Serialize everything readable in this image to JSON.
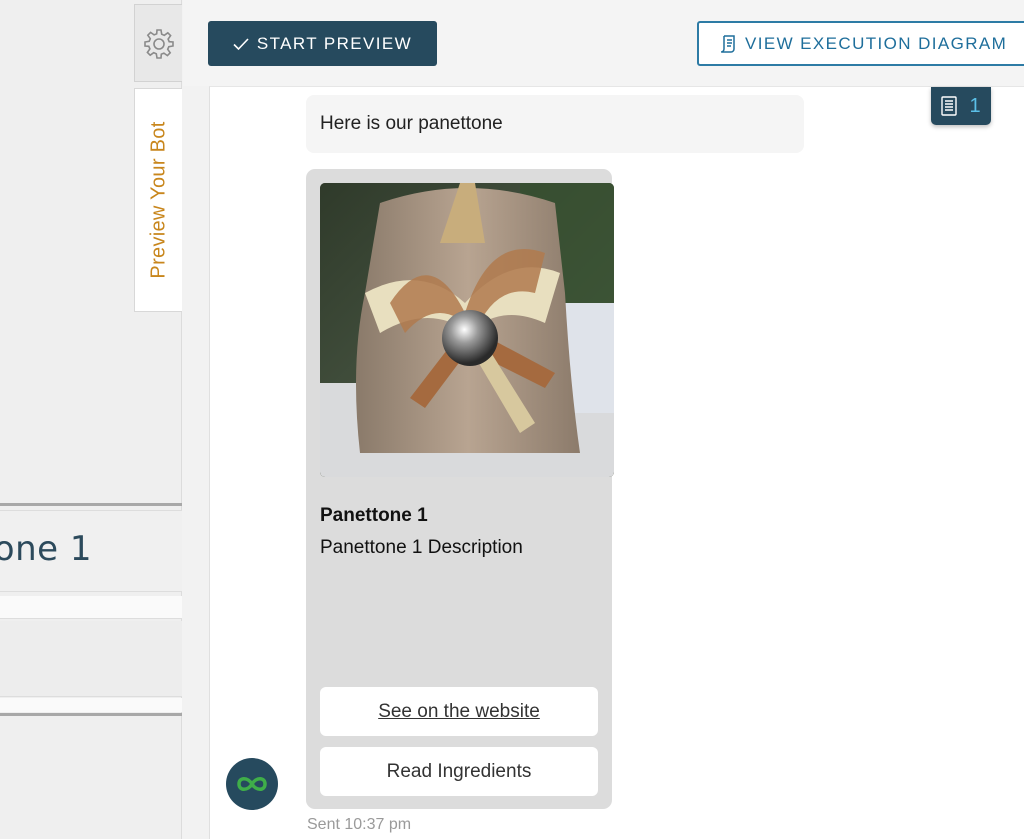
{
  "sidebar": {
    "preview_tab_label": "Preview Your Bot",
    "item_name_fragment": "one 1"
  },
  "toolbar": {
    "start_preview_label": "START PREVIEW",
    "view_diagram_label": "VIEW EXECUTION DIAGRAM"
  },
  "log_badge": {
    "count": "1"
  },
  "chat": {
    "message_text": "Here is our panettone",
    "card": {
      "image_description_icon": "panettone-photo",
      "title": "Panettone 1",
      "description": "Panettone 1 Description",
      "buttons": [
        {
          "label": "See on the website"
        },
        {
          "label": "Read Ingredients"
        }
      ]
    },
    "sent_time": "Sent 10:37 pm"
  },
  "colors": {
    "primary_dark": "#264a5e",
    "accent_orange": "#c8861c",
    "link_blue": "#1e6e9b",
    "badge_text": "#5bc0e8",
    "bot_avatar_green": "#3fae49"
  }
}
